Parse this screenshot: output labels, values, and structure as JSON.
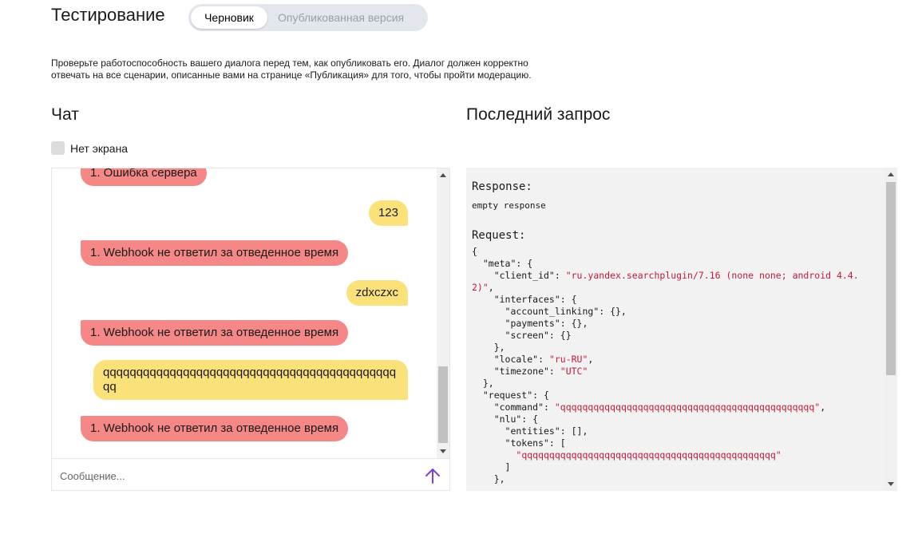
{
  "header": {
    "title": "Тестирование",
    "tabs": [
      "Черновик",
      "Опубликованная версия"
    ]
  },
  "description": [
    "Проверьте работоспособность вашего диалога перед тем, как опубликовать его. Диалог должен корректно",
    "отвечать на все сценарии, описанные вами на странице «Публикация» для того, чтобы пройти модерацию."
  ],
  "chat": {
    "title": "Чат",
    "no_screen_label": "Нет экрана",
    "messages": [
      {
        "from": "bot",
        "text": "1. Ошибка сервера"
      },
      {
        "from": "user",
        "text": "123"
      },
      {
        "from": "bot",
        "text": "1. Webhook не ответил за отведенное время"
      },
      {
        "from": "user",
        "text": "zdxczxc"
      },
      {
        "from": "bot",
        "text": "1. Webhook не ответил за отведенное время"
      },
      {
        "from": "user",
        "text": "qqqqqqqqqqqqqqqqqqqqqqqqqqqqqqqqqqqqqqqqqqqqqq"
      },
      {
        "from": "bot",
        "text": "1. Webhook не ответил за отведенное время"
      }
    ],
    "input_placeholder": "Сообщение...",
    "send_icon": "arrow-up-icon"
  },
  "last_request": {
    "title": "Последний запрос",
    "response_label": "Response:",
    "response_value": "empty response",
    "request_label": "Request:",
    "code_lines": [
      [
        {
          "t": "{"
        }
      ],
      [
        {
          "t": "  \"meta\": {"
        }
      ],
      [
        {
          "t": "    \"client_id\": "
        },
        {
          "t": "\"ru.yandex.searchplugin/7.16 (none none; android 4.4.",
          "s": true
        }
      ],
      [
        {
          "t": "2)\"",
          "s": true
        },
        {
          "t": ","
        }
      ],
      [
        {
          "t": "    \"interfaces\": {"
        }
      ],
      [
        {
          "t": "      \"account_linking\": {},"
        }
      ],
      [
        {
          "t": "      \"payments\": {},"
        }
      ],
      [
        {
          "t": "      \"screen\": {}"
        }
      ],
      [
        {
          "t": "    },"
        }
      ],
      [
        {
          "t": "    \"locale\": "
        },
        {
          "t": "\"ru-RU\"",
          "s": true
        },
        {
          "t": ","
        }
      ],
      [
        {
          "t": "    \"timezone\": "
        },
        {
          "t": "\"UTC\"",
          "s": true
        }
      ],
      [
        {
          "t": "  },"
        }
      ],
      [
        {
          "t": "  \"request\": {"
        }
      ],
      [
        {
          "t": "    \"command\": "
        },
        {
          "t": "\"qqqqqqqqqqqqqqqqqqqqqqqqqqqqqqqqqqqqqqqqqqqqqq\"",
          "s": true
        },
        {
          "t": ","
        }
      ],
      [
        {
          "t": "    \"nlu\": {"
        }
      ],
      [
        {
          "t": "      \"entities\": [],"
        }
      ],
      [
        {
          "t": "      \"tokens\": ["
        }
      ],
      [
        {
          "t": "        "
        },
        {
          "t": "\"qqqqqqqqqqqqqqqqqqqqqqqqqqqqqqqqqqqqqqqqqqqqqq\"",
          "s": true
        }
      ],
      [
        {
          "t": "      ]"
        }
      ],
      [
        {
          "t": "    },"
        }
      ]
    ]
  },
  "colors": {
    "bot_bubble": "#f58787",
    "user_bubble": "#fae17a",
    "send_arrow": "#7b3fe4",
    "code_string": "#c41a3a"
  }
}
